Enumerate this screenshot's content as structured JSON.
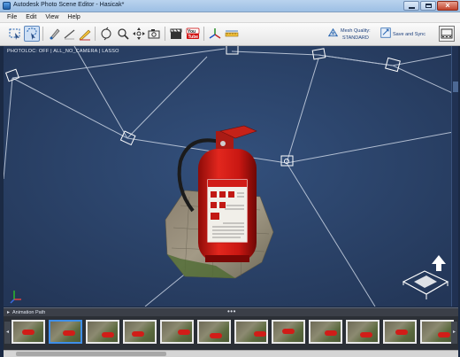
{
  "window": {
    "title": "Autodesk Photo Scene Editor - Hasicak*"
  },
  "menu": {
    "items": [
      "File",
      "Edit",
      "View",
      "Help"
    ]
  },
  "toolbar": {
    "mesh_quality_label": "Mesh Quality:",
    "mesh_quality_value": "STANDARD",
    "save_sync_label": "Save and Sync"
  },
  "viewport": {
    "status_text": "PHOTOLOC: OFF | ALL_NO_CAMERA | LASSO"
  },
  "animation_path": {
    "label": "Animation Path",
    "frame_count": 12,
    "selected_frame": 1
  },
  "colors": {
    "accent": "#3f8fe8",
    "viewport_bg": "#2a3e62",
    "extinguisher_red": "#d11d18"
  }
}
